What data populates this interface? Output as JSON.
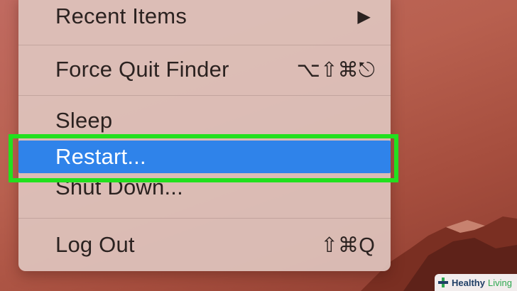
{
  "menu": {
    "items": [
      {
        "label": "Recent Items",
        "shortcut": "▶"
      },
      {
        "label": "Force Quit Finder",
        "shortcut": "⌥⇧⌘⎋"
      },
      {
        "label": "Sleep",
        "shortcut": ""
      },
      {
        "label": "Restart...",
        "shortcut": ""
      },
      {
        "label": "Shut Down...",
        "shortcut": ""
      },
      {
        "label": "Log Out",
        "shortcut": "⇧⌘Q"
      }
    ],
    "highlight_color": "#2f83ea"
  },
  "annotation": {
    "color": "#22e01e"
  },
  "watermark": {
    "brand1": "Healthy",
    "brand2": "Living"
  }
}
